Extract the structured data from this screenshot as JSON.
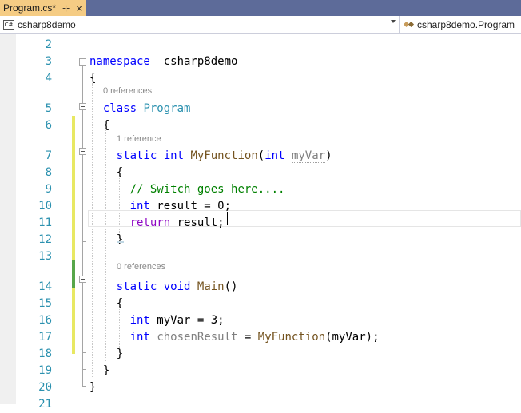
{
  "tab": {
    "title": "Program.cs*",
    "pin_glyph": "⊹",
    "close_glyph": "×"
  },
  "navbar": {
    "project_badge": "C#",
    "project": "csharp8demo",
    "class": "csharp8demo.Program"
  },
  "refs": {
    "line5": "0 references",
    "line7": "1 reference",
    "line14": "0 references"
  },
  "lines": [
    {
      "num": "2"
    },
    {
      "num": "3",
      "t": [
        [
          "kw",
          "namespace"
        ],
        [
          "",
          "  csharp8demo"
        ]
      ]
    },
    {
      "num": "4",
      "t": [
        [
          "",
          "{"
        ]
      ]
    },
    {
      "num": "5",
      "t": [
        [
          "",
          "  "
        ],
        [
          "kw",
          "class"
        ],
        [
          "",
          " "
        ],
        [
          "type",
          "Program"
        ]
      ]
    },
    {
      "num": "6",
      "t": [
        [
          "",
          "  {"
        ]
      ]
    },
    {
      "num": "7",
      "t": [
        [
          "",
          "    "
        ],
        [
          "kw",
          "static"
        ],
        [
          "",
          " "
        ],
        [
          "kw",
          "int"
        ],
        [
          "",
          " "
        ],
        [
          "fn",
          "MyFunction"
        ],
        [
          "",
          "("
        ],
        [
          "kw",
          "int"
        ],
        [
          "",
          " "
        ],
        [
          "param-unused",
          "myVar"
        ],
        [
          "",
          ")"
        ]
      ]
    },
    {
      "num": "8",
      "t": [
        [
          "",
          "    {"
        ]
      ]
    },
    {
      "num": "9",
      "t": [
        [
          "",
          "      "
        ],
        [
          "comment",
          "// Switch goes here...."
        ]
      ]
    },
    {
      "num": "10",
      "t": [
        [
          "",
          "      "
        ],
        [
          "kw",
          "int"
        ],
        [
          "",
          " result = 0;"
        ]
      ]
    },
    {
      "num": "11",
      "t": [
        [
          "",
          "      "
        ],
        [
          "ctl",
          "return"
        ],
        [
          "",
          " result;"
        ]
      ]
    },
    {
      "num": "12",
      "t": [
        [
          "",
          "    }"
        ]
      ]
    },
    {
      "num": "13"
    },
    {
      "num": "14",
      "t": [
        [
          "",
          "    "
        ],
        [
          "kw",
          "static"
        ],
        [
          "",
          " "
        ],
        [
          "kw",
          "void"
        ],
        [
          "",
          " "
        ],
        [
          "fn",
          "Main"
        ],
        [
          "",
          "()"
        ]
      ]
    },
    {
      "num": "15",
      "t": [
        [
          "",
          "    {"
        ]
      ]
    },
    {
      "num": "16",
      "t": [
        [
          "",
          "      "
        ],
        [
          "kw",
          "int"
        ],
        [
          "",
          " myVar = 3;"
        ]
      ]
    },
    {
      "num": "17",
      "t": [
        [
          "",
          "      "
        ],
        [
          "kw",
          "int"
        ],
        [
          "",
          " "
        ],
        [
          "param-unused",
          "chosenResult"
        ],
        [
          "",
          " = "
        ],
        [
          "fn",
          "MyFunction"
        ],
        [
          "",
          "(myVar);"
        ]
      ]
    },
    {
      "num": "18",
      "t": [
        [
          "",
          "    }"
        ]
      ]
    },
    {
      "num": "19",
      "t": [
        [
          "",
          "  }"
        ]
      ]
    },
    {
      "num": "20",
      "t": [
        [
          "",
          "}"
        ]
      ]
    },
    {
      "num": "21"
    }
  ],
  "colors": {
    "tab_active": "#f5cc84",
    "tab_strip": "#5d6b99",
    "line_number": "#2b91af",
    "keyword": "#0000ff",
    "control_keyword": "#8f08c4",
    "type": "#2b91af",
    "comment": "#008000",
    "unsaved_change": "#e8e862",
    "saved_change": "#57a64a"
  }
}
